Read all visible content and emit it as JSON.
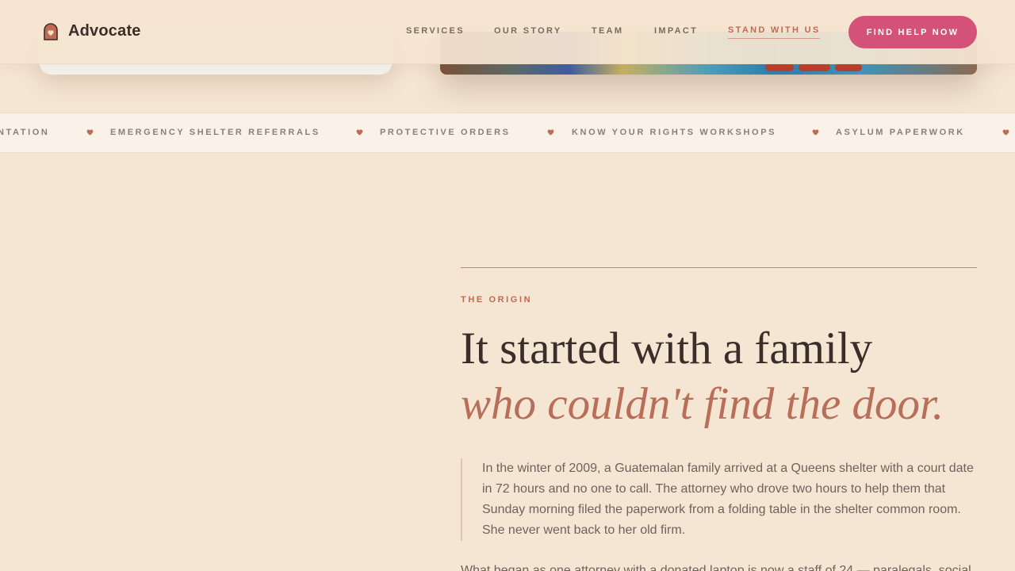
{
  "brand": {
    "name": "Advocate",
    "icon": "house-heart-icon"
  },
  "nav": {
    "items": [
      {
        "label": "SERVICES"
      },
      {
        "label": "OUR STORY"
      },
      {
        "label": "TEAM"
      },
      {
        "label": "IMPACT"
      },
      {
        "label": "STAND WITH US",
        "active": true
      }
    ],
    "cta_label": "FIND HELP NOW"
  },
  "marquee": {
    "items": [
      "NTATION",
      "EMERGENCY SHELTER REFERRALS",
      "PROTECTIVE ORDERS",
      "KNOW YOUR RIGHTS WORKSHOPS",
      "ASYLUM PAPERWORK"
    ],
    "separator_icon": "heart-icon"
  },
  "origin": {
    "eyebrow": "THE ORIGIN",
    "headline_line1": "It started with a family",
    "headline_line2": "who couldn't find the door.",
    "quote": "In the winter of 2009, a Guatemalan family arrived at a Queens shelter with a court date in 72 hours and no one to call. The attorney who drove two hours to help them that Sunday morning filed the paperwork from a folding table in the shelter common room. She never went back to her old firm.",
    "body": "What began as one attorney with a donated laptop is now a staff of 24 — paralegals, social"
  },
  "colors": {
    "background": "#f5e6d3",
    "accent": "#c06a52",
    "cta": "#d4527a",
    "text_dark": "#3a2e2a",
    "text_muted": "#6e625c"
  }
}
